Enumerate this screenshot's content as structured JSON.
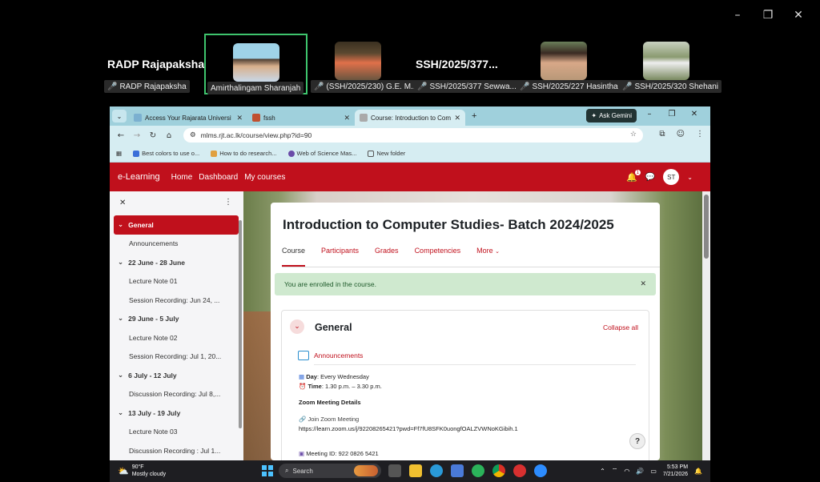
{
  "meeting": {
    "window_controls": [
      "–",
      "❐",
      "✕"
    ],
    "participants": [
      {
        "display_name": "RADP Rajapaksha",
        "label": "RADP Rajapaksha",
        "muted": true,
        "has_video": false
      },
      {
        "display_name": "",
        "label": "Amirthalingam Sharanjah",
        "muted": false,
        "has_video": true,
        "speaking": true
      },
      {
        "display_name": "",
        "label": "(SSH/2025/230) G.E. M...",
        "muted": true,
        "has_video": true
      },
      {
        "display_name": "SSH/2025/377...",
        "label": "SSH/2025/377  Sewwa...",
        "muted": true,
        "has_video": false
      },
      {
        "display_name": "",
        "label": "SSH/2025/227 Hasintha",
        "muted": true,
        "has_video": true
      },
      {
        "display_name": "",
        "label": "SSH/2025/320 Shehani",
        "muted": true,
        "has_video": true
      }
    ]
  },
  "browser": {
    "tabs": [
      {
        "title": "Access Your Rajarata University",
        "active": false
      },
      {
        "title": "fssh",
        "active": false
      },
      {
        "title": "Course: Introduction to Compu",
        "active": true
      }
    ],
    "new_tab": "+",
    "ask_gemini": "Ask Gemini",
    "url": "mlms.rjt.ac.lk/course/view.php?id=90",
    "bookmarks": [
      "Best colors to use o...",
      "How to do research...",
      "Web of Science Mas...",
      "New folder"
    ]
  },
  "moodle": {
    "brand": "e-Learning",
    "nav": [
      "Home",
      "Dashboard",
      "My courses"
    ],
    "notification_count": "1",
    "user_initials": "ST",
    "course_index": [
      {
        "label": "General",
        "type": "section",
        "current": true
      },
      {
        "label": "Announcements",
        "type": "item"
      },
      {
        "label": "22 June - 28 June",
        "type": "section"
      },
      {
        "label": "Lecture Note 01",
        "type": "item"
      },
      {
        "label": "Session Recording: Jun 24, ...",
        "type": "item"
      },
      {
        "label": "29 June - 5 July",
        "type": "section"
      },
      {
        "label": "Lecture Note 02",
        "type": "item"
      },
      {
        "label": "Session Recording: Jul 1, 20...",
        "type": "item"
      },
      {
        "label": "6 July - 12 July",
        "type": "section"
      },
      {
        "label": "Discussion Recording: Jul 8,...",
        "type": "item"
      },
      {
        "label": "13 July - 19 July",
        "type": "section"
      },
      {
        "label": "Lecture Note 03",
        "type": "item"
      },
      {
        "label": "Discussion Recording : Jul 1...",
        "type": "item"
      }
    ],
    "course_title": "Introduction to Computer Studies- Batch 2024/2025",
    "course_tabs": [
      "Course",
      "Participants",
      "Grades",
      "Competencies",
      "More"
    ],
    "enrolled_alert": "You are enrolled in the course.",
    "section_title": "General",
    "collapse_all": "Collapse all",
    "activity_title": "Announcements",
    "day_label": "Day",
    "day_value": ": Every Wednesday",
    "time_label": "Time",
    "time_value": ": 1.30 p.m. – 3.30 p.m.",
    "zoom_heading": "Zoom Meeting Details",
    "join_zoom": "Join Zoom Meeting",
    "zoom_link": "https://learn.zoom.us/j/92208265421?pwd=Ff7fU8SFK0uongfOALZVWNoKGibih.1",
    "meeting_id": "Meeting ID: 922 0826 5421",
    "help": "?"
  },
  "taskbar": {
    "temperature": "90°F",
    "weather": "Mostly cloudy",
    "search_placeholder": "Search",
    "time": "5:53 PM",
    "date": "7/21/2026"
  }
}
